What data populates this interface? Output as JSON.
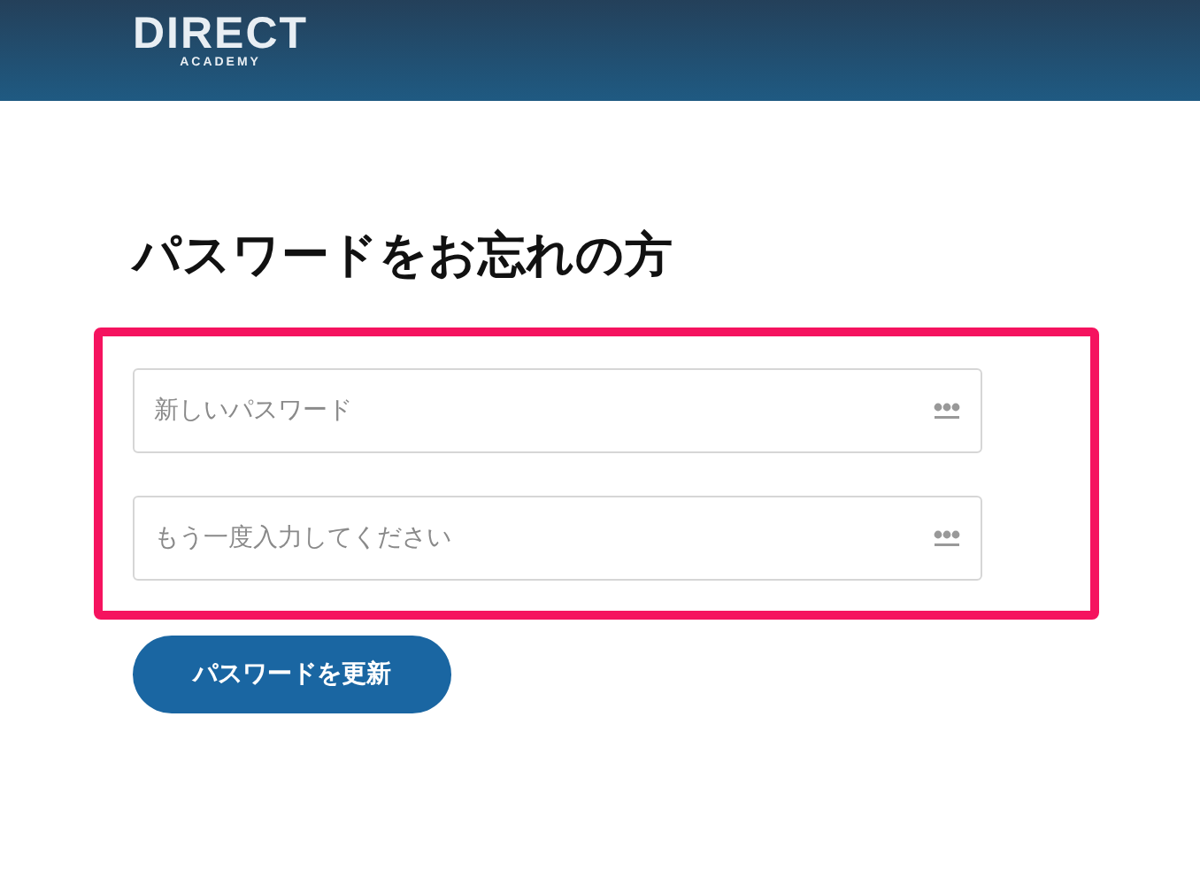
{
  "header": {
    "logo": {
      "title": "DIRECT",
      "subtitle": "ACADEMY"
    }
  },
  "page": {
    "title": "パスワードをお忘れの方"
  },
  "fields": [
    {
      "placeholder": "新しいパスワード"
    },
    {
      "placeholder": "もう一度入力してください"
    }
  ],
  "buttons": [
    {
      "label": "パスワードを更新"
    }
  ]
}
